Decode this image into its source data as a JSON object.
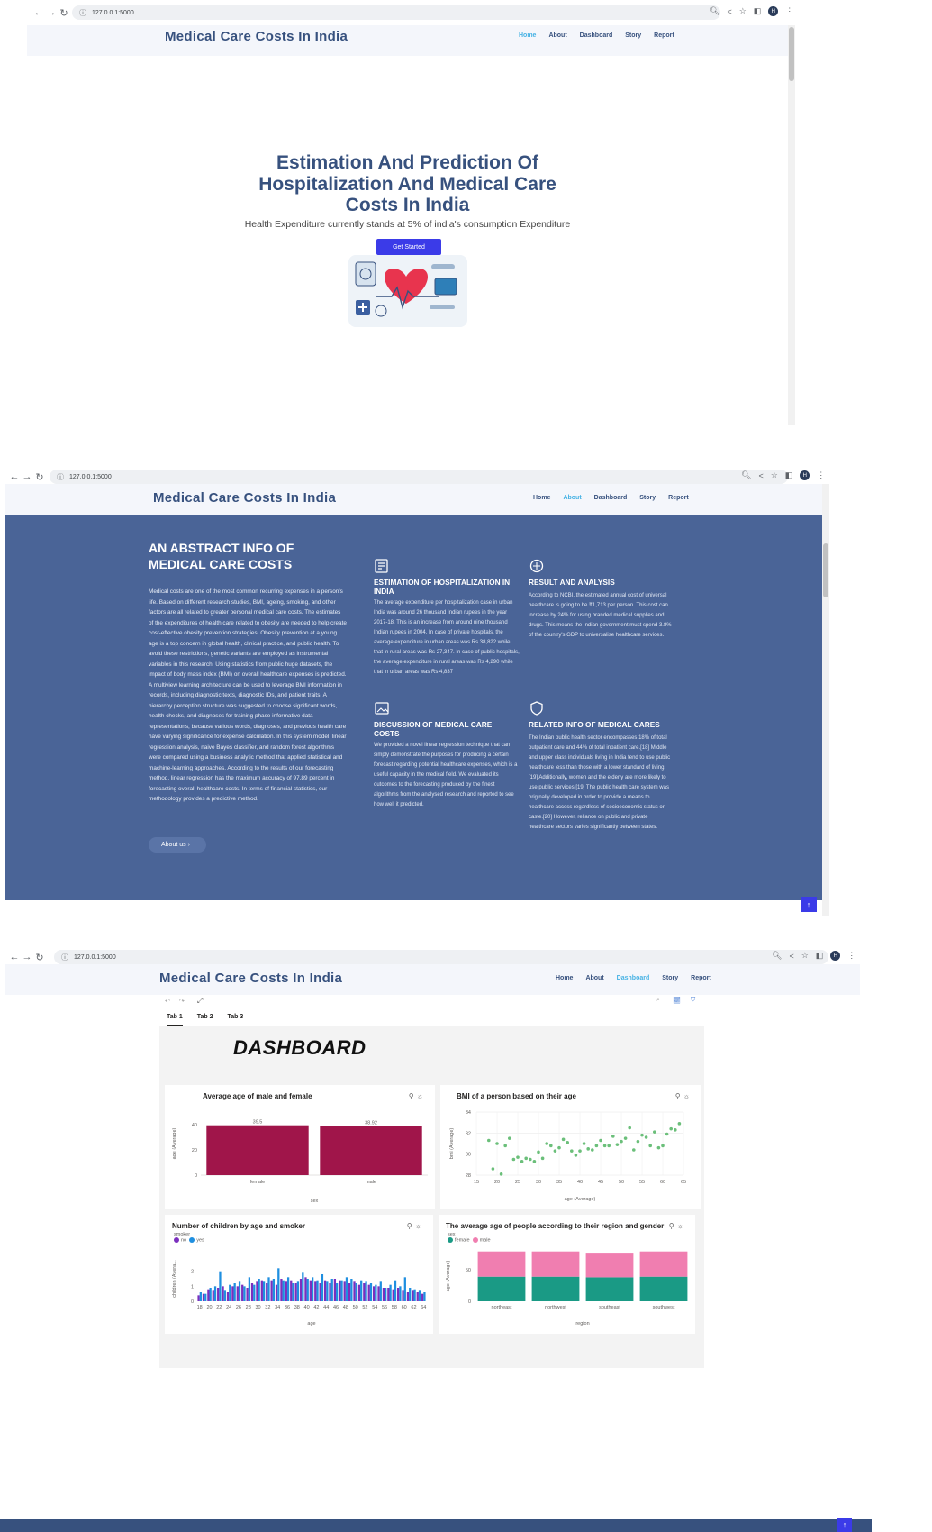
{
  "browser": {
    "url": "127.0.0.1:5000",
    "back_icon": "arrow-left-icon",
    "forward_icon": "arrow-right-icon",
    "reload_icon": "reload-icon",
    "profile_initial": "H"
  },
  "site": {
    "logo": "Medical Care Costs In India",
    "menu": [
      "Home",
      "About",
      "Dashboard",
      "Story",
      "Report"
    ]
  },
  "hero": {
    "title_line1": "Estimation And Prediction Of",
    "title_line2": "Hospitalization And Medical Care",
    "title_line3": "Costs In India",
    "subtitle": "Health Expenditure currently stands at 5% of india's consumption Expenditure",
    "cta": "Get Started"
  },
  "about": {
    "heading_line1": "AN ABSTRACT INFO OF",
    "heading_line2": "MEDICAL CARE COSTS",
    "body": "Medical costs are one of the most common recurring expenses in a person's life. Based on different research studies, BMI, ageing, smoking, and other factors are all related to greater personal medical care costs. The estimates of the expenditures of health care related to obesity are needed to help create cost-effective obesity prevention strategies. Obesity prevention at a young age is a top concern in global health, clinical practice, and public health. To avoid these restrictions, genetic variants are employed as instrumental variables in this research. Using statistics from public huge datasets, the impact of body mass index (BMI) on overall healthcare expenses is predicted. A multiview learning architecture can be used to leverage BMI information in records, including diagnostic texts, diagnostic IDs, and patient traits. A hierarchy perception structure was suggested to choose significant words, health checks, and diagnoses for training phase informative data representations, because various words, diagnoses, and previous health care have varying significance for expense calculation. In this system model, linear regression analysis, naive Bayes classifier, and random forest algorithms were compared using a business analytic method that applied statistical and machine-learning approaches. According to the results of our forecasting method, linear regression has the maximum accuracy of 97.89 percent in forecasting overall healthcare costs. In terms of financial statistics, our methodology provides a predictive method.",
    "button": "About us ›",
    "cards": [
      {
        "icon": "document-icon",
        "title": "ESTIMATION OF HOSPITALIZATION IN INDIA",
        "text": "The average expenditure per hospitalization case in urban India was around 26 thousand Indian rupees in the year 2017-18. This is an increase from around nine thousand Indian rupees in 2004. In case of private hospitals, the average expenditure in urban areas was Rs 38,822 while that in rural areas was Rs 27,347. In case of public hospitals, the average expenditure in rural areas was Rs 4,290 while that in urban areas was Rs 4,837"
      },
      {
        "icon": "analysis-icon",
        "title": "RESULT AND ANALYSIS",
        "text": "According to NCBI, the estimated annual cost of universal healthcare is going to be ₹1,713 per person. This cost can increase by 24% for using branded medical supplies and drugs. This means the Indian government must spend 3.8% of the country's GDP to universalise healthcare services."
      },
      {
        "icon": "image-icon",
        "title": "DISCUSSION OF MEDICAL CARE COSTS",
        "text": "We provided a novel linear regression technique that can simply demonstrate the purposes for producing a certain forecast regarding potential healthcare expenses, which is a useful capacity in the medical field. We evaluated its outcomes to the forecasting produced by the finest algorithms from the analysed research and reported to see how well it predicted."
      },
      {
        "icon": "shield-icon",
        "title": "RELATED INFO OF MEDICAL CARES",
        "text": "The Indian public health sector encompasses 18% of total outpatient care and 44% of total inpatient care.[18] Middle and upper class individuals living in India tend to use public healthcare less than those with a lower standard of living.[19] Additionally, women and the elderly are more likely to use public services.[19] The public health care system was originally developed in order to provide a means to healthcare access regardless of socioeconomic status or caste.[20] However, reliance on public and private healthcare sectors varies significantly between states."
      }
    ]
  },
  "dashboard": {
    "tabs": [
      "Tab 1",
      "Tab 2",
      "Tab 3"
    ],
    "title": "DASHBOARD",
    "colors": {
      "bar": "#a0154a",
      "scatter": "#6bbf7a",
      "smoker_no": "#7b2fbe",
      "smoker_yes": "#1f8fe0",
      "female": "#f07eb0",
      "male": "#1a9a85"
    }
  },
  "chart_data": [
    {
      "type": "bar",
      "title": "Average age of male and female",
      "xlabel": "sex",
      "ylabel": "age (Average)",
      "categories": [
        "female",
        "male"
      ],
      "values": [
        39.5,
        38.92
      ],
      "value_labels": [
        "39.5",
        "38.92"
      ],
      "yticks": [
        "0",
        "20",
        "40"
      ],
      "ylim": [
        0,
        50
      ]
    },
    {
      "type": "scatter",
      "title": "BMI of a person  based on their age",
      "xlabel": "age (Average)",
      "ylabel": "bmi (Average)",
      "xticks": [
        "15",
        "20",
        "25",
        "30",
        "35",
        "40",
        "45",
        "50",
        "55",
        "60",
        "65"
      ],
      "yticks": [
        "28",
        "30",
        "32",
        "34"
      ],
      "xlim": [
        15,
        65
      ],
      "ylim": [
        28,
        34
      ],
      "points": [
        [
          18,
          31.3
        ],
        [
          19,
          28.6
        ],
        [
          20,
          31.0
        ],
        [
          21,
          28.1
        ],
        [
          22,
          30.8
        ],
        [
          23,
          31.5
        ],
        [
          24,
          29.5
        ],
        [
          25,
          29.7
        ],
        [
          26,
          29.3
        ],
        [
          27,
          29.6
        ],
        [
          28,
          29.5
        ],
        [
          29,
          29.3
        ],
        [
          30,
          30.2
        ],
        [
          31,
          29.6
        ],
        [
          32,
          31.0
        ],
        [
          33,
          30.8
        ],
        [
          34,
          30.3
        ],
        [
          35,
          30.6
        ],
        [
          36,
          31.4
        ],
        [
          37,
          31.1
        ],
        [
          38,
          30.3
        ],
        [
          39,
          29.9
        ],
        [
          40,
          30.3
        ],
        [
          41,
          31.0
        ],
        [
          42,
          30.5
        ],
        [
          43,
          30.4
        ],
        [
          44,
          30.8
        ],
        [
          45,
          31.3
        ],
        [
          46,
          30.8
        ],
        [
          47,
          30.8
        ],
        [
          48,
          31.7
        ],
        [
          49,
          30.9
        ],
        [
          50,
          31.2
        ],
        [
          51,
          31.5
        ],
        [
          52,
          32.5
        ],
        [
          53,
          30.4
        ],
        [
          54,
          31.2
        ],
        [
          55,
          31.8
        ],
        [
          56,
          31.6
        ],
        [
          57,
          30.8
        ],
        [
          58,
          32.1
        ],
        [
          59,
          30.6
        ],
        [
          60,
          30.8
        ],
        [
          61,
          31.9
        ],
        [
          62,
          32.4
        ],
        [
          63,
          32.3
        ],
        [
          64,
          32.9
        ]
      ]
    },
    {
      "type": "bar",
      "title": "Number of children by age and smoker",
      "xlabel": "age",
      "ylabel": "children (Avera...",
      "legend_title": "smoker",
      "legend": [
        "no",
        "yes"
      ],
      "xticks": [
        "18",
        "20",
        "22",
        "24",
        "26",
        "28",
        "30",
        "32",
        "34",
        "36",
        "38",
        "40",
        "42",
        "44",
        "46",
        "48",
        "50",
        "52",
        "54",
        "56",
        "58",
        "60",
        "62",
        "64"
      ],
      "yticks": [
        "0",
        "1",
        "2"
      ],
      "ylim": [
        0,
        3
      ],
      "categories": [
        18,
        19,
        20,
        21,
        22,
        23,
        24,
        25,
        26,
        27,
        28,
        29,
        30,
        31,
        32,
        33,
        34,
        35,
        36,
        37,
        38,
        39,
        40,
        41,
        42,
        43,
        44,
        45,
        46,
        47,
        48,
        49,
        50,
        51,
        52,
        53,
        54,
        55,
        56,
        57,
        58,
        59,
        60,
        61,
        62,
        63,
        64
      ],
      "series": [
        {
          "name": "no",
          "values": [
            0.4,
            0.5,
            0.8,
            0.7,
            0.9,
            1.0,
            0.6,
            1.0,
            1.0,
            1.1,
            0.9,
            1.2,
            1.3,
            1.4,
            1.2,
            1.4,
            1.1,
            1.5,
            1.3,
            1.4,
            1.2,
            1.5,
            1.6,
            1.4,
            1.3,
            1.2,
            1.4,
            1.2,
            1.5,
            1.4,
            1.3,
            1.2,
            1.3,
            1.1,
            1.2,
            1.1,
            1.0,
            1.0,
            0.9,
            0.9,
            0.8,
            0.9,
            0.7,
            0.6,
            0.7,
            0.6,
            0.5
          ]
        },
        {
          "name": "yes",
          "values": [
            0.6,
            0.5,
            0.9,
            1.0,
            2.0,
            0.7,
            1.1,
            1.2,
            1.3,
            1.0,
            1.6,
            1.1,
            1.5,
            1.3,
            1.6,
            1.5,
            2.2,
            1.4,
            1.6,
            1.2,
            1.3,
            1.9,
            1.5,
            1.6,
            1.4,
            1.8,
            1.3,
            1.5,
            1.2,
            1.4,
            1.6,
            1.5,
            1.2,
            1.4,
            1.3,
            1.2,
            1.1,
            1.3,
            0.9,
            1.1,
            1.4,
            1.0,
            1.6,
            0.9,
            0.8,
            0.7,
            0.6
          ]
        }
      ]
    },
    {
      "type": "bar",
      "title": "The average age of people according to their region and gender",
      "xlabel": "region",
      "ylabel": "age (Average)",
      "legend_title": "sex",
      "legend": [
        "female",
        "male"
      ],
      "yticks": [
        "0",
        "50"
      ],
      "ylim": [
        0,
        80
      ],
      "categories": [
        "northeast",
        "northwest",
        "southeast",
        "southwest"
      ],
      "series": [
        {
          "name": "male",
          "values": [
            39,
            39,
            38,
            39
          ]
        },
        {
          "name": "female",
          "values": [
            40,
            40,
            39,
            40
          ]
        }
      ]
    }
  ]
}
